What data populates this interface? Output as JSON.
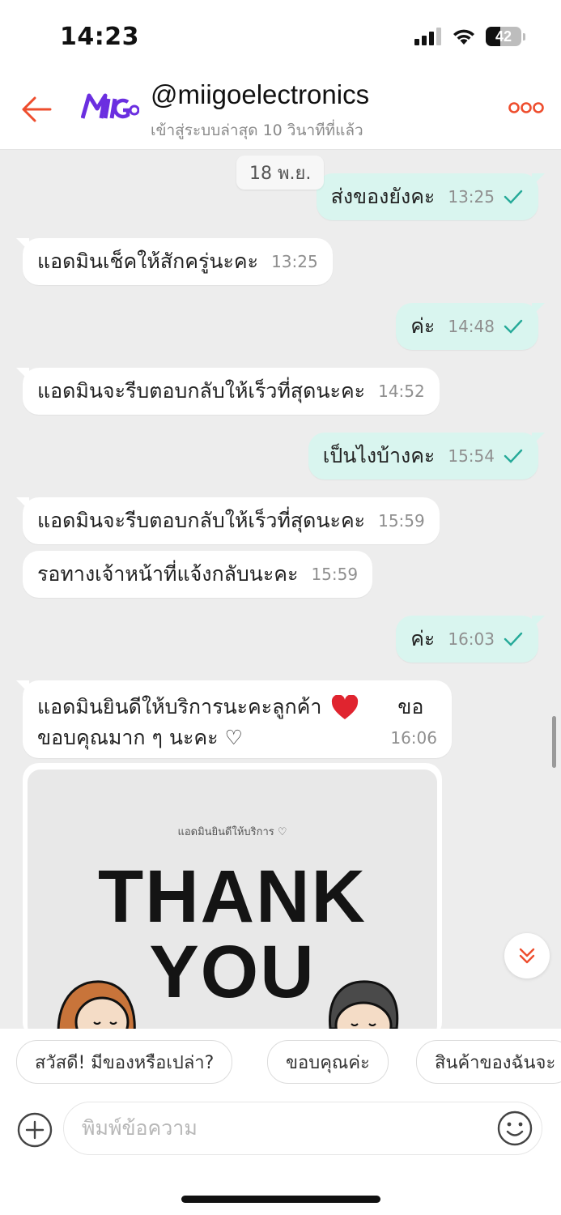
{
  "status_bar": {
    "time": "14:23",
    "battery": "42"
  },
  "header": {
    "logo_text": "MIIGO",
    "shop_name": "@miigoelectronics",
    "last_seen": "เข้าสู่ระบบล่าสุด 10 วินาทีที่แล้ว",
    "icons": [
      "back-arrow-icon",
      "more-icon"
    ]
  },
  "chat": {
    "date_separator": "18 พ.ย.",
    "messages": [
      {
        "side": "out",
        "text": "ส่งของยังคะ",
        "time": "13:25",
        "status": "sent"
      },
      {
        "side": "in",
        "text": "แอดมินเช็คให้สักครู่นะคะ",
        "time": "13:25"
      },
      {
        "side": "out",
        "text": "ค่ะ",
        "time": "14:48",
        "status": "sent"
      },
      {
        "side": "in",
        "text": "แอดมินจะรีบตอบกลับให้เร็วที่สุดนะคะ",
        "time": "14:52"
      },
      {
        "side": "out",
        "text": "เป็นไงบ้างคะ",
        "time": "15:54",
        "status": "sent"
      },
      {
        "side": "in",
        "text": "แอดมินจะรีบตอบกลับให้เร็วที่สุดนะคะ",
        "time": "15:59"
      },
      {
        "side": "in",
        "text": "รอทางเจ้าหน้าที่แจ้งกลับนะคะ",
        "time": "15:59"
      },
      {
        "side": "out",
        "text": "ค่ะ",
        "time": "16:03",
        "status": "sent"
      },
      {
        "side": "in",
        "line1_a": "แอดมินยินดีให้บริการนะคะลูกค้า",
        "line1_b": "ขอ",
        "line2": "ขอบคุณมาก ๆ นะคะ ♡",
        "time": "16:06"
      }
    ],
    "image": {
      "caption": "แอดมินยินดีให้บริการ ♡",
      "line1": "THANK",
      "line2": "YOU"
    }
  },
  "quick_replies": [
    "สวัสดี! มีของหรือเปล่า?",
    "ขอบคุณค่ะ",
    "สินค้าของฉันจะ"
  ],
  "composer": {
    "placeholder": "พิมพ์ข้อความ"
  },
  "colors": {
    "accent": "#ee4d2d",
    "outgoing_bubble": "#d9f5ef",
    "check": "#26aa99"
  }
}
